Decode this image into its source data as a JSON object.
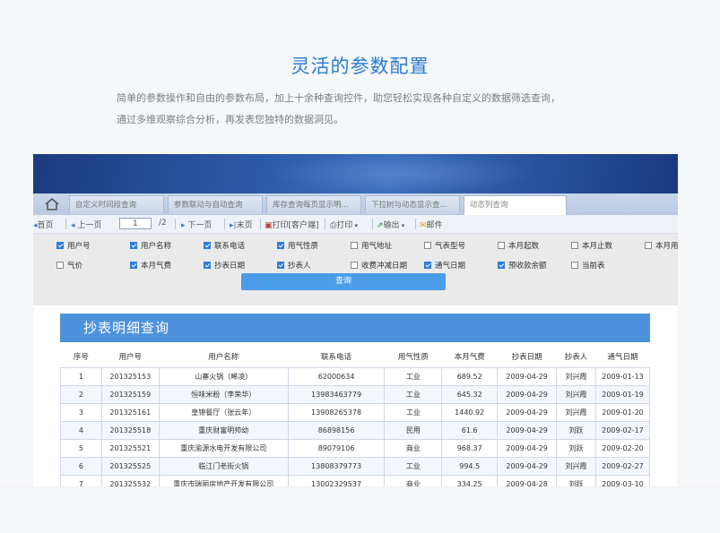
{
  "heading": "灵活的参数配置",
  "description": [
    "简单的参数操作和自由的参数布局，加上十余种查询控件，助您轻松实现各种自定义的数据筛选查询，",
    "通过多维观察综合分析，再发表您独特的数据洞见。"
  ],
  "tabs": [
    "自定义时间段查询",
    "参数联动与自动查询",
    "库存查询每页显示明...",
    "下拉树与动态显示查...",
    "动态列查询"
  ],
  "pager": {
    "first": "首页",
    "prev": "上一页",
    "page_value": "1",
    "total": "/2",
    "next": "下一页",
    "last": "末页",
    "print_client": "打印[客户端]",
    "print": "打印",
    "export": "输出",
    "mail": "邮件"
  },
  "filters": [
    {
      "label": "用户号",
      "checked": true
    },
    {
      "label": "用户名称",
      "checked": true
    },
    {
      "label": "联系电话",
      "checked": true
    },
    {
      "label": "用气性质",
      "checked": true
    },
    {
      "label": "用气地址",
      "checked": false
    },
    {
      "label": "气表型号",
      "checked": false
    },
    {
      "label": "本月起数",
      "checked": false
    },
    {
      "label": "本月止数",
      "checked": false
    },
    {
      "label": "本月用",
      "checked": false
    },
    {
      "label": "气价",
      "checked": false
    },
    {
      "label": "本月气费",
      "checked": true
    },
    {
      "label": "抄表日期",
      "checked": true
    },
    {
      "label": "抄表人",
      "checked": true
    },
    {
      "label": "收费冲减日期",
      "checked": false
    },
    {
      "label": "通气日期",
      "checked": true
    },
    {
      "label": "预收款余额",
      "checked": true
    },
    {
      "label": "当前表",
      "checked": false
    }
  ],
  "query_button": "查询",
  "panel_title": "抄表明细查询",
  "table": {
    "headers": [
      "序号",
      "用户号",
      "用户名称",
      "联系电话",
      "用气性质",
      "本月气费",
      "抄表日期",
      "抄表人",
      "通气日期"
    ],
    "rows": [
      [
        "1",
        "201325153",
        "山寨火锅（晞凌）",
        "62000634",
        "工业",
        "689.52",
        "2009-04-29",
        "刘兴霞",
        "2009-01-13"
      ],
      [
        "2",
        "201325159",
        "恒味米粉（李荣华）",
        "13983463779",
        "工业",
        "645.32",
        "2009-04-29",
        "刘兴霞",
        "2009-01-19"
      ],
      [
        "3",
        "201325161",
        "皇锦餐厅（张云年）",
        "13908265378",
        "工业",
        "1440.92",
        "2009-04-29",
        "刘兴霞",
        "2009-01-20"
      ],
      [
        "4",
        "201325518",
        "重庆财富明帅幼",
        "86898156",
        "民用",
        "61.6",
        "2009-04-29",
        "刘跃",
        "2009-02-17"
      ],
      [
        "5",
        "201325521",
        "重庆渝源水电开发有限公司",
        "89079106",
        "商业",
        "968.37",
        "2009-04-29",
        "刘跃",
        "2009-02-20"
      ],
      [
        "6",
        "201325525",
        "临江门老街火锅",
        "13808379773",
        "工业",
        "994.5",
        "2009-04-29",
        "刘兴霞",
        "2009-02-27"
      ],
      [
        "7",
        "201325532",
        "重庆市瑞丽房地产开发有限公司",
        "13002329537",
        "商业",
        "334.25",
        "2009-04-28",
        "刘跃",
        "2009-03-10"
      ]
    ]
  }
}
